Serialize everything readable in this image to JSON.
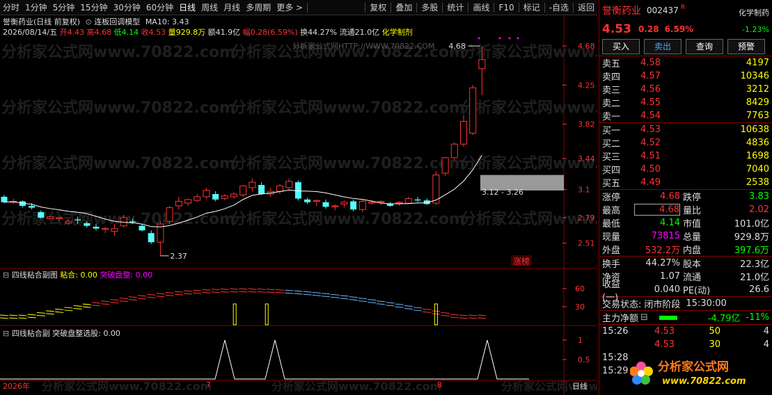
{
  "toolbar": {
    "periods": [
      "分时",
      "1分钟",
      "5分钟",
      "15分钟",
      "30分钟",
      "60分钟",
      "日线",
      "周线",
      "月线",
      "多周期",
      "更多 >"
    ],
    "active_index": 6,
    "actions": [
      "复权",
      "叠加",
      "多股",
      "统计",
      "画线",
      "F10",
      "标记",
      "-自选",
      "返回"
    ]
  },
  "chart_header": {
    "title": "誉衡药业(日线 前复权)",
    "model": "连板回调模型",
    "ma": "MA10: 3.43",
    "date": "2026/08/14/五",
    "open": "开4.43",
    "high": "高4.68",
    "low": "低4.14",
    "close": "收4.53",
    "volume": "量929.8万",
    "amount": "额41.9亿",
    "amp": "幅0.28(6.59%)",
    "turnover": "换44.27%",
    "float": "流通21.0亿",
    "sector": "化学制剂"
  },
  "watermarks": [
    "分析家公式网www.70822.com",
    "分析家公式网HTTP://WWW.70822.COM"
  ],
  "chart_data": [
    {
      "type": "candlestick",
      "title": "誉衡药业(日线 前复权)",
      "y_ticks": [
        4.68,
        4.25,
        3.82,
        3.44,
        3.1,
        2.79,
        2.51
      ],
      "ylim": [
        2.3,
        4.75
      ],
      "up_color": "#ff3232",
      "down_color": "#54ffff",
      "candles": [
        {
          "o": 3.02,
          "h": 3.04,
          "l": 2.95,
          "c": 2.96
        },
        {
          "o": 2.96,
          "h": 3.0,
          "l": 2.94,
          "c": 2.97
        },
        {
          "o": 2.97,
          "h": 2.98,
          "l": 2.9,
          "c": 2.92
        },
        {
          "o": 2.92,
          "h": 2.95,
          "l": 2.88,
          "c": 2.9
        },
        {
          "o": 2.85,
          "h": 2.87,
          "l": 2.78,
          "c": 2.79
        },
        {
          "o": 2.78,
          "h": 2.81,
          "l": 2.76,
          "c": 2.8
        },
        {
          "o": 2.78,
          "h": 2.8,
          "l": 2.75,
          "c": 2.79
        },
        {
          "o": 2.73,
          "h": 2.77,
          "l": 2.71,
          "c": 2.75
        },
        {
          "o": 2.77,
          "h": 2.8,
          "l": 2.72,
          "c": 2.76
        },
        {
          "o": 2.73,
          "h": 2.75,
          "l": 2.68,
          "c": 2.7
        },
        {
          "o": 2.69,
          "h": 2.72,
          "l": 2.65,
          "c": 2.67
        },
        {
          "o": 2.66,
          "h": 2.69,
          "l": 2.62,
          "c": 2.67
        },
        {
          "o": 2.64,
          "h": 2.72,
          "l": 2.59,
          "c": 2.67
        },
        {
          "o": 2.7,
          "h": 2.82,
          "l": 2.68,
          "c": 2.79
        },
        {
          "o": 2.75,
          "h": 2.78,
          "l": 2.72,
          "c": 2.74
        },
        {
          "o": 2.7,
          "h": 2.72,
          "l": 2.64,
          "c": 2.65
        },
        {
          "o": 2.62,
          "h": 2.65,
          "l": 2.5,
          "c": 2.52
        },
        {
          "o": 2.52,
          "h": 2.75,
          "l": 2.37,
          "c": 2.72
        },
        {
          "o": 2.75,
          "h": 2.92,
          "l": 2.72,
          "c": 2.9
        },
        {
          "o": 2.92,
          "h": 3.02,
          "l": 2.88,
          "c": 2.97
        },
        {
          "o": 2.95,
          "h": 3.0,
          "l": 2.92,
          "c": 2.99
        },
        {
          "o": 2.98,
          "h": 3.05,
          "l": 2.96,
          "c": 3.02
        },
        {
          "o": 3.02,
          "h": 3.12,
          "l": 2.99,
          "c": 3.09
        },
        {
          "o": 3.05,
          "h": 3.08,
          "l": 2.97,
          "c": 2.99
        },
        {
          "o": 3.0,
          "h": 3.05,
          "l": 2.98,
          "c": 3.03
        },
        {
          "o": 3.02,
          "h": 3.07,
          "l": 3.0,
          "c": 3.05
        },
        {
          "o": 3.04,
          "h": 3.15,
          "l": 3.02,
          "c": 3.14
        },
        {
          "o": 3.12,
          "h": 3.22,
          "l": 3.08,
          "c": 3.18
        },
        {
          "o": 3.15,
          "h": 3.18,
          "l": 3.04,
          "c": 3.05
        },
        {
          "o": 3.05,
          "h": 3.12,
          "l": 3.02,
          "c": 3.08
        },
        {
          "o": 3.08,
          "h": 3.16,
          "l": 3.05,
          "c": 3.14
        },
        {
          "o": 3.12,
          "h": 3.22,
          "l": 3.1,
          "c": 3.19
        },
        {
          "o": 3.18,
          "h": 3.2,
          "l": 2.98,
          "c": 3.0
        },
        {
          "o": 2.99,
          "h": 3.01,
          "l": 2.94,
          "c": 2.96
        },
        {
          "o": 2.97,
          "h": 2.99,
          "l": 2.92,
          "c": 2.98
        },
        {
          "o": 2.96,
          "h": 2.99,
          "l": 2.89,
          "c": 2.91
        },
        {
          "o": 2.91,
          "h": 2.94,
          "l": 2.87,
          "c": 2.92
        },
        {
          "o": 2.94,
          "h": 2.98,
          "l": 2.9,
          "c": 2.96
        },
        {
          "o": 2.97,
          "h": 2.99,
          "l": 2.86,
          "c": 2.88
        },
        {
          "o": 2.88,
          "h": 2.99,
          "l": 2.85,
          "c": 2.97
        },
        {
          "o": 2.95,
          "h": 2.98,
          "l": 2.93,
          "c": 2.96
        },
        {
          "o": 2.96,
          "h": 2.98,
          "l": 2.93,
          "c": 2.97
        },
        {
          "o": 2.94,
          "h": 2.96,
          "l": 2.91,
          "c": 2.92
        },
        {
          "o": 2.95,
          "h": 2.97,
          "l": 2.92,
          "c": 2.96
        },
        {
          "o": 2.95,
          "h": 3.02,
          "l": 2.94,
          "c": 3.0
        },
        {
          "o": 2.99,
          "h": 3.02,
          "l": 2.96,
          "c": 2.98
        },
        {
          "o": 2.98,
          "h": 3.0,
          "l": 2.93,
          "c": 2.94
        },
        {
          "o": 2.95,
          "h": 3.3,
          "l": 2.93,
          "c": 3.26
        },
        {
          "o": 3.28,
          "h": 3.46,
          "l": 3.25,
          "c": 3.45
        },
        {
          "o": 3.45,
          "h": 3.62,
          "l": 3.42,
          "c": 3.6
        },
        {
          "o": 3.6,
          "h": 3.92,
          "l": 3.57,
          "c": 3.85
        },
        {
          "o": 3.72,
          "h": 4.25,
          "l": 3.7,
          "c": 4.22
        },
        {
          "o": 4.43,
          "h": 4.68,
          "l": 4.14,
          "c": 4.53
        }
      ],
      "ma10_label": "MA10: 3.43",
      "annotations": {
        "high": "4.68",
        "low": "2.37",
        "range": "3.12 - 3.26",
        "tag": "涨榜"
      }
    },
    {
      "type": "line",
      "title": "四线粘合副图",
      "series": [
        {
          "name": "粘合",
          "value": "0.00"
        },
        {
          "name": "突破盘整",
          "value": "0.00"
        }
      ],
      "y_ticks": [
        60.0,
        30.0
      ],
      "spike_positions": [
        21,
        26,
        47
      ]
    },
    {
      "type": "line",
      "title": "四线粘合副",
      "series": [
        {
          "name": "突破盘整选股",
          "value": "0.00"
        }
      ],
      "y_ticks": [
        1.0,
        0.5
      ],
      "ylim": [
        0,
        1.05
      ],
      "spike_positions": [
        21,
        26,
        47
      ]
    }
  ],
  "sub1": {
    "title": "四线粘合副图",
    "l1": "粘合:",
    "v1": "0.00",
    "l2": "突破盘整:",
    "v2": "0.00"
  },
  "sub2": {
    "title": "四线粘合副",
    "l1": "突破盘整选股:",
    "v1": "0.00"
  },
  "bottom": {
    "year": "2026年",
    "m7": "7",
    "m8": "8",
    "period": "日线"
  },
  "right": {
    "name": "誉衡药业",
    "code": "002437",
    "flag": "R",
    "sector": "化学制药",
    "price": "4.53",
    "change": "0.28",
    "pct": "6.59%",
    "sector_pct": "-1.23%",
    "buttons": [
      "买入",
      "卖出",
      "查询",
      "预警"
    ],
    "asks": [
      {
        "label": "卖五",
        "price": "4.58",
        "vol": "4197"
      },
      {
        "label": "卖四",
        "price": "4.57",
        "vol": "10346"
      },
      {
        "label": "卖三",
        "price": "4.56",
        "vol": "3212"
      },
      {
        "label": "卖二",
        "price": "4.55",
        "vol": "8429"
      },
      {
        "label": "卖一",
        "price": "4.54",
        "vol": "7763"
      }
    ],
    "bids": [
      {
        "label": "买一",
        "price": "4.53",
        "vol": "10638"
      },
      {
        "label": "买二",
        "price": "4.52",
        "vol": "4836"
      },
      {
        "label": "买三",
        "price": "4.51",
        "vol": "1698"
      },
      {
        "label": "买四",
        "price": "4.50",
        "vol": "7040"
      },
      {
        "label": "买五",
        "price": "4.49",
        "vol": "2538"
      }
    ],
    "stats": [
      {
        "l1": "涨停",
        "v1": "4.68",
        "l2": "跌停",
        "v2": "3.83"
      },
      {
        "l1": "最高",
        "v1": "4.68",
        "l2": "量比",
        "v2": "2.02"
      },
      {
        "l1": "最低",
        "v1": "4.14",
        "l2": "市值",
        "v2": "101.0亿"
      },
      {
        "l1": "现量",
        "v1": "73815",
        "l2": "总量",
        "v2": "929.8万"
      },
      {
        "l1": "外盘",
        "v1": "532.2万",
        "l2": "内盘",
        "v2": "397.6万"
      }
    ],
    "stats2": [
      {
        "l1": "换手",
        "v1": "44.27%",
        "l2": "股本",
        "v2": "22.3亿"
      },
      {
        "l1": "净资",
        "v1": "1.07",
        "l2": "流通",
        "v2": "21.0亿"
      },
      {
        "l1": "收益(一)",
        "v1": "0.040",
        "l2": "PE(动)",
        "v2": "26.6"
      }
    ],
    "trade_state_label": "交易状态:",
    "trade_state": "闭市阶段",
    "trade_time": "15:30:00",
    "flow_label": "主力净额",
    "flow_val": "-4.79亿",
    "flow_pct": "-11%",
    "ticks": [
      {
        "t": "15:26",
        "p": "4.53",
        "v": "50",
        "n": "4"
      },
      {
        "t": "",
        "p": "4.53",
        "v": "30",
        "n": "4"
      },
      {
        "t": "15:28",
        "p": "",
        "v": "",
        "n": ""
      },
      {
        "t": "15:29",
        "p": "",
        "v": "",
        "n": ""
      }
    ],
    "logo_text": "分析家公式网",
    "logo_url": "www.70822.com"
  }
}
